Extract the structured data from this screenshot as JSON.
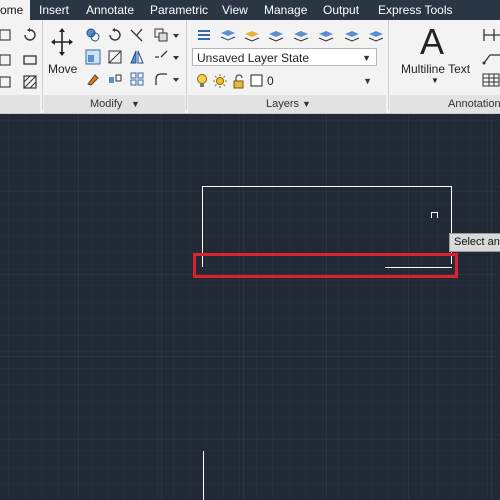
{
  "ribbon_tabs": [
    {
      "label": "ome",
      "active": true
    },
    {
      "label": "Insert"
    },
    {
      "label": "Annotate"
    },
    {
      "label": "Parametric"
    },
    {
      "label": "View"
    },
    {
      "label": "Manage"
    },
    {
      "label": "Output"
    },
    {
      "label": "Express Tools"
    }
  ],
  "modify_panel": {
    "title": "Modify",
    "move_label": "Move"
  },
  "layers_panel": {
    "title": "Layers",
    "layer_state": "Unsaved Layer State",
    "current_layer": "0"
  },
  "annotation_panel": {
    "title": "Annotation",
    "multiline_text_label": "Multiline Text",
    "big_glyph": "A"
  },
  "tooltip": {
    "text": "Select an"
  },
  "colors": {
    "canvas_bg": "#222936",
    "grid_minor": "#2a3240",
    "grid_major": "#313a48",
    "drawing": "#ffffff",
    "highlight": "#e0202a"
  }
}
